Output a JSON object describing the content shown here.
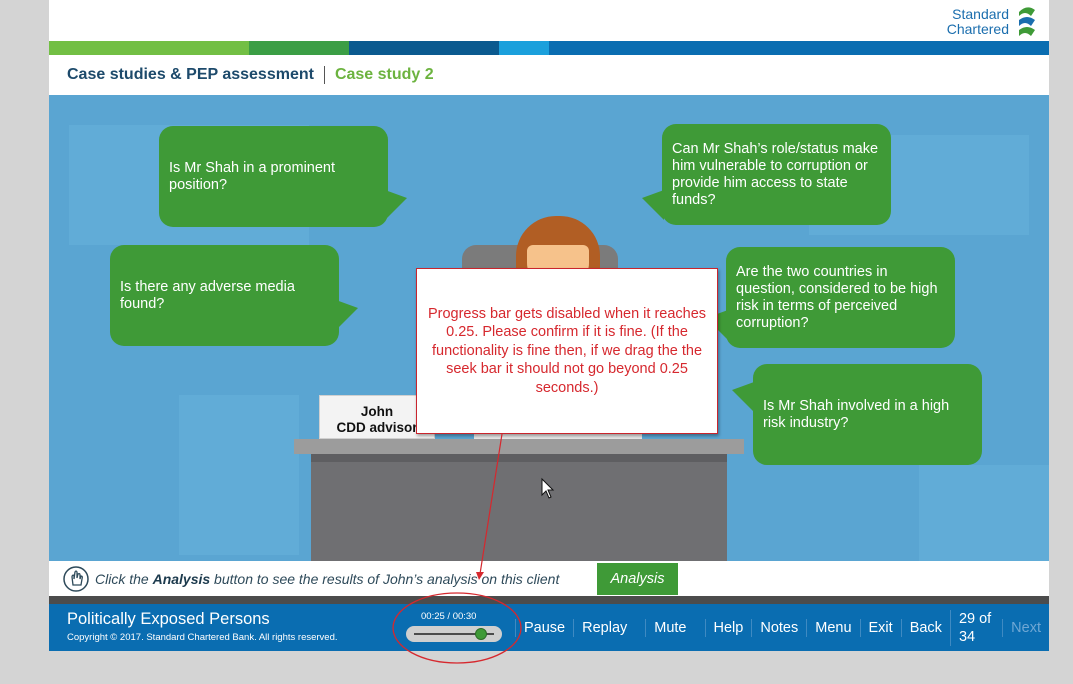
{
  "logo": {
    "line1": "Standard",
    "line2": "Chartered"
  },
  "header": {
    "course": "Case studies & PEP assessment",
    "case": "Case study 2"
  },
  "stripe_colors": [
    "#72bf44",
    "#3b9e45",
    "#0b5a8f",
    "#1ba0dc",
    "#0a6db1"
  ],
  "bubbles": {
    "b1": "Is Mr Shah in a prominent position?",
    "b2": "Can Mr Shah’s role/status make him vulnerable to corruption or provide him access to state funds?",
    "b3": "Is there any adverse media found?",
    "b4": "Are the two countries in question, considered to be high risk in terms of perceived corruption?",
    "b5": "Is Mr Shah involved in a high risk industry?"
  },
  "nameplate": {
    "name": "John",
    "role": "CDD advisor"
  },
  "annotation": {
    "text": "Progress bar gets disabled when it reaches 0.25. Please confirm if it is fine. (If the functionality is fine then, if we drag the the seek bar it should not go beyond 0.25 seconds.)"
  },
  "instruction": {
    "pre": "Click the ",
    "bold": "Analysis",
    "post": " button to see the results of John’s analysis on this client",
    "button": "Analysis"
  },
  "footer": {
    "title": "Politically Exposed Persons",
    "copyright": "Copyright © 2017. Standard Chartered Bank. All rights reserved.",
    "time": "00:25 / 00:30",
    "progress": 0.833,
    "nav": {
      "pause": "Pause",
      "replay": "Replay",
      "mute": "Mute",
      "help": "Help",
      "notes": "Notes",
      "menu": "Menu",
      "exit": "Exit",
      "back": "Back",
      "page": "29 of 34",
      "next": "Next"
    }
  },
  "colors": {
    "brand_blue": "#0a6db1",
    "accent_green": "#3f9a37",
    "annotation_red": "#d6282e"
  }
}
